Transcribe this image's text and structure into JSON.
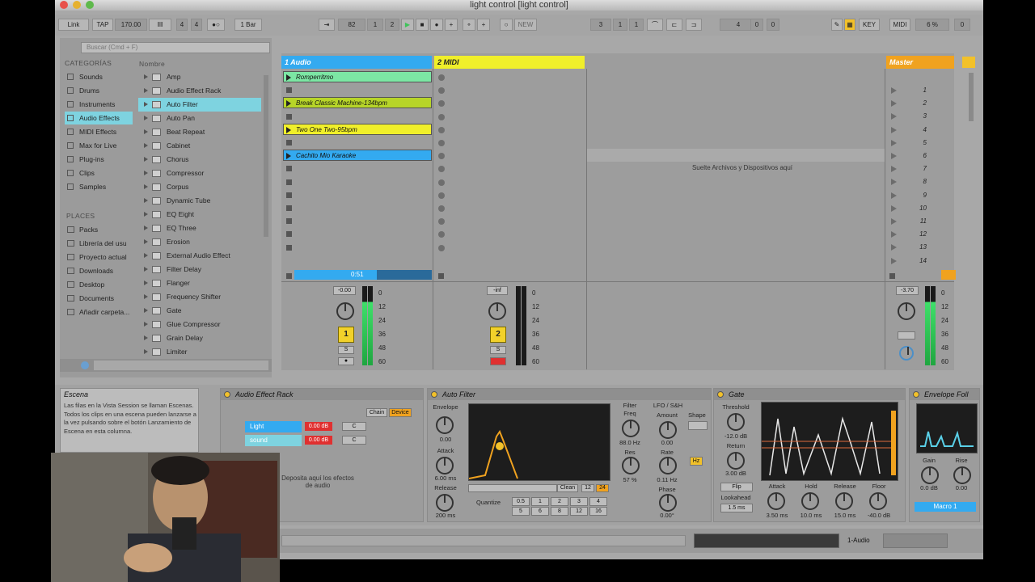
{
  "window": {
    "title": "light control  [light control]"
  },
  "transport": {
    "link": "Link",
    "tap": "TAP",
    "tempo": "170.00",
    "sig_num": "4",
    "sig_den": "4",
    "quantize": "1 Bar",
    "pos_bar": "82",
    "pos_beat": "1",
    "pos_sixteenth": "2",
    "new": "NEW",
    "loop_start_bar": "3",
    "loop_start_beat": "1",
    "loop_start_six": "1",
    "loop_len_bar": "4",
    "loop_len_beat": "0",
    "loop_len_six": "0",
    "key": "KEY",
    "midi": "MIDI",
    "cpu": "6 %",
    "overload": "0"
  },
  "browser": {
    "search_placeholder": "Buscar (Cmd + F)",
    "categories_header": "CATEGORÍAS",
    "name_header": "Nombre",
    "places_header": "PLACES",
    "categories": [
      "Sounds",
      "Drums",
      "Instruments",
      "Audio Effects",
      "MIDI Effects",
      "Max for Live",
      "Plug-ins",
      "Clips",
      "Samples"
    ],
    "selected_category": 3,
    "places": [
      "Packs",
      "Librería del usu",
      "Proyecto actual",
      "Downloads",
      "Desktop",
      "Documents",
      "Añadir carpeta..."
    ],
    "items": [
      "Amp",
      "Audio Effect Rack",
      "Auto Filter",
      "Auto Pan",
      "Beat Repeat",
      "Cabinet",
      "Chorus",
      "Compressor",
      "Corpus",
      "Dynamic Tube",
      "EQ Eight",
      "EQ Three",
      "Erosion",
      "External Audio Effect",
      "Filter Delay",
      "Flanger",
      "Frequency Shifter",
      "Gate",
      "Glue Compressor",
      "Grain Delay",
      "Limiter"
    ],
    "selected_item": 2
  },
  "session": {
    "tracks": [
      {
        "name": "1 Audio",
        "color": "#33aaf0"
      },
      {
        "name": "2 MIDI",
        "color": "#f0ef2a"
      },
      {
        "name": "Master",
        "color": "#f0a21f"
      }
    ],
    "clips": [
      {
        "row": 0,
        "name": "Romperritmo",
        "color": "#7ce6a4"
      },
      {
        "row": 2,
        "name": "Break Classic Machine-134bpm",
        "color": "#b7d528"
      },
      {
        "row": 4,
        "name": "Two One Two-95bpm",
        "color": "#f0ef2a"
      },
      {
        "row": 6,
        "name": "Cachito Mio Karaoke",
        "color": "#33aaf0"
      }
    ],
    "drop_hint": "Suelte Archivos y Dispositivos aquí",
    "scenes": [
      "1",
      "2",
      "3",
      "4",
      "5",
      "6",
      "7",
      "8",
      "9",
      "10",
      "11",
      "12",
      "13",
      "14"
    ],
    "progress_time": "0:51",
    "track1_vol": "-0.00",
    "track2_vol": "-inf",
    "master_vol": "-3.70",
    "meter_scale": [
      "0",
      "12",
      "24",
      "36",
      "48",
      "60"
    ],
    "track1_number": "1",
    "track2_number": "2",
    "track1_meter_level": 0.8,
    "track2_meter_level": 0.0,
    "master_meter_level": 0.85
  },
  "info": {
    "title": "Escena",
    "text": "Las filas en la Vista Session se llaman Escenas. Todos los clips en una escena pueden lanzarse a la vez pulsando sobre el botón Lanzamiento de Escena en esta columna."
  },
  "rack": {
    "title": "Audio Effect Rack",
    "chain_btn": "Chain",
    "device_btn": "Device",
    "chains": [
      {
        "name": "Light",
        "vol": "0.00 dB",
        "pan": "C"
      },
      {
        "name": "sound",
        "vol": "0.00 dB",
        "pan": "C"
      }
    ],
    "drop_hint": "Deposita aquí los efectos de audio"
  },
  "autofilter": {
    "title": "Auto Filter",
    "envelope": "Envelope",
    "env_val": "0.00",
    "attack": "Attack",
    "attack_val": "6.00 ms",
    "release": "Release",
    "release_val": "200 ms",
    "filter": "Filter",
    "freq": "Freq",
    "freq_val": "88.0 Hz",
    "res": "Res",
    "res_val": "57 %",
    "lfo": "LFO / S&H",
    "amount": "Amount",
    "amount_val": "0.00",
    "rate": "Rate",
    "rate_val": "0.11 Hz",
    "phase": "Phase",
    "phase_val": "0.00°",
    "shape": "Shape",
    "hz": "Hz",
    "clean": "Clean",
    "slope_a": "12",
    "slope_b": "24",
    "quantize": "Quantize",
    "q_vals": [
      "0.5",
      "1",
      "2",
      "3",
      "4",
      "5",
      "6",
      "8",
      "12",
      "16"
    ]
  },
  "gate": {
    "title": "Gate",
    "threshold": "Threshold",
    "threshold_val": "-12.0 dB",
    "return": "Return",
    "return_val": "3.00 dB",
    "flip": "Flip",
    "lookahead": "Lookahead",
    "lookahead_val": "1.5 ms",
    "attack": "Attack",
    "attack_val": "3.50 ms",
    "hold": "Hold",
    "hold_val": "10.0 ms",
    "release": "Release",
    "release_val": "15.0 ms",
    "floor": "Floor",
    "floor_val": "-40.0 dB",
    "scale": [
      "0",
      "-6",
      "-12",
      "-18",
      "-24",
      "-30",
      "-36",
      "-42",
      "-48"
    ]
  },
  "envfollow": {
    "title": "Envelope Foll",
    "gain": "Gain",
    "gain_val": "0.0 dB",
    "rise": "Rise",
    "rise_val": "0.00",
    "macro": "Macro 1"
  },
  "status": {
    "track_label": "1-Audio"
  },
  "colors": {
    "selection": "#7ed3e0",
    "orange": "#f0a21f",
    "yellow": "#f2d12a",
    "red": "#e03030",
    "meter": "#3fe06a"
  }
}
